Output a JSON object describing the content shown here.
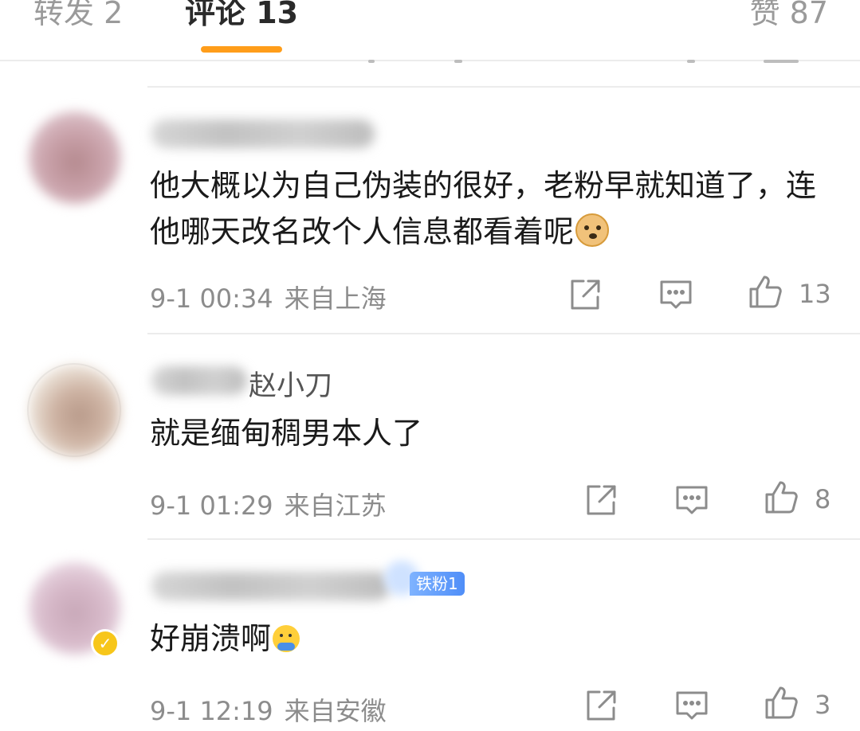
{
  "tabs": {
    "repost": "转发 2",
    "comments": "评论 13",
    "likes": "赞 87"
  },
  "comments": [
    {
      "name_suffix": "",
      "badge": "",
      "text": "他大概以为自己伪装的很好，老粉早就知道了，连他哪天改名改个人信息都看着呢",
      "emoji": "doge-emoji",
      "time": "9-1 00:34",
      "location": "来自上海",
      "likes": "13"
    },
    {
      "name_suffix": "赵小刀",
      "badge": "",
      "text": "就是缅甸稠男本人了",
      "emoji": "",
      "time": "9-1 01:29",
      "location": "来自江苏",
      "likes": "8"
    },
    {
      "name_suffix": "",
      "badge": "铁粉1",
      "text": "好崩溃啊",
      "emoji": "collapse-emoji",
      "time": "9-1 12:19",
      "location": "来自安徽",
      "likes": "3"
    }
  ],
  "colors": {
    "accent": "#ff9d1a",
    "badge": "#4f8ef8",
    "meta_text": "#8c8c8c"
  }
}
